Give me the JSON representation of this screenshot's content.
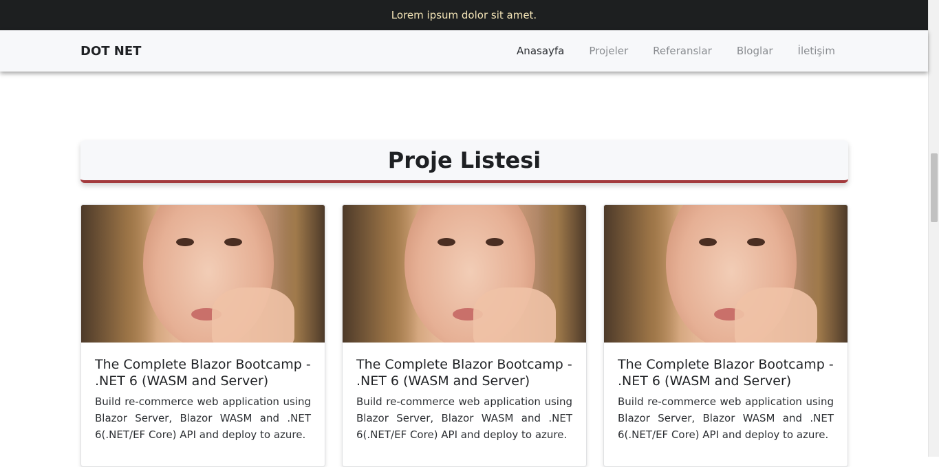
{
  "topbar": {
    "text": "Lorem ipsum dolor sit amet."
  },
  "navbar": {
    "brand": "DOT NET",
    "links": [
      {
        "label": "Anasayfa",
        "active": true
      },
      {
        "label": "Projeler",
        "active": false
      },
      {
        "label": "Referanslar",
        "active": false
      },
      {
        "label": "Bloglar",
        "active": false
      },
      {
        "label": "İletişim",
        "active": false
      }
    ]
  },
  "section": {
    "title": "Proje Listesi"
  },
  "projects": [
    {
      "title": "The Complete Blazor Bootcamp - .NET 6 (WASM and Server)",
      "description": "Build re-commerce web application using Blazor Server, Blazor WASM and .NET 6(.NET/EF Core) API and deploy to azure."
    },
    {
      "title": "The Complete Blazor Bootcamp - .NET 6 (WASM and Server)",
      "description": "Build re-commerce web application using Blazor Server, Blazor WASM and .NET 6(.NET/EF Core) API and deploy to azure."
    },
    {
      "title": "The Complete Blazor Bootcamp - .NET 6 (WASM and Server)",
      "description": "Build re-commerce web application using Blazor Server, Blazor WASM and .NET 6(.NET/EF Core) API and deploy to azure."
    }
  ],
  "colors": {
    "topbar_bg": "#1d1f20",
    "topbar_text": "#f2e3b6",
    "navbar_bg": "#f7f8fa",
    "accent": "#a33a3d"
  }
}
